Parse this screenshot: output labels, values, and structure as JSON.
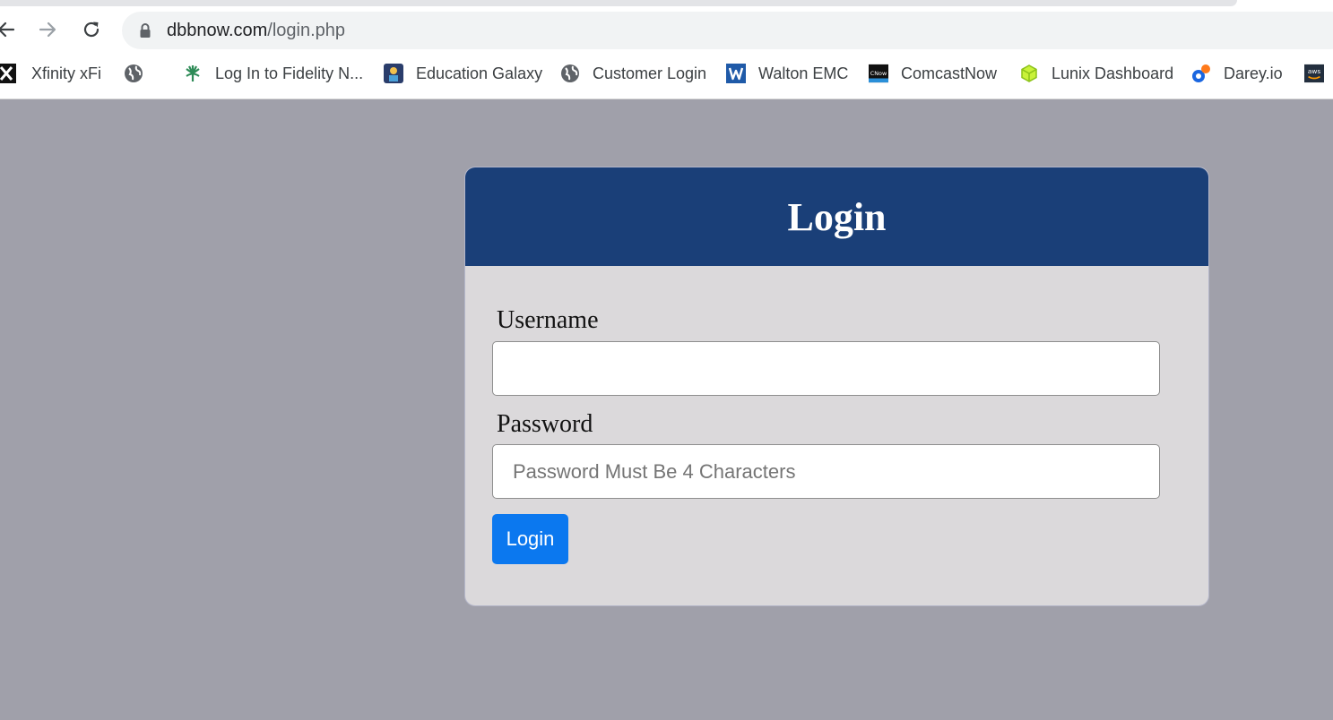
{
  "browser": {
    "url": {
      "domain": "dbbnow.com",
      "path": "/login.php"
    },
    "bookmarks": [
      {
        "label": "Xfinity xFi",
        "icon": "xfinity-x-icon"
      },
      {
        "label": "",
        "icon": "globe-icon"
      },
      {
        "label": "Log In to Fidelity N...",
        "icon": "fidelity-icon"
      },
      {
        "label": "Education Galaxy",
        "icon": "education-galaxy-icon"
      },
      {
        "label": "Customer Login",
        "icon": "globe-icon"
      },
      {
        "label": "Walton EMC",
        "icon": "walton-w-icon"
      },
      {
        "label": "ComcastNow",
        "icon": "comcastnow-icon"
      },
      {
        "label": "Lunix Dashboard",
        "icon": "cube-icon"
      },
      {
        "label": "Darey.io",
        "icon": "darey-icon"
      },
      {
        "label": "",
        "icon": "aws-icon"
      }
    ]
  },
  "login": {
    "title": "Login",
    "username_label": "Username",
    "username_value": "",
    "password_label": "Password",
    "password_placeholder": "Password Must Be 4 Characters",
    "submit_label": "Login"
  },
  "colors": {
    "page_bg": "#a0a0aa",
    "card_header": "#1a3f78",
    "card_body": "#dbd9db",
    "button": "#0b78ef"
  }
}
